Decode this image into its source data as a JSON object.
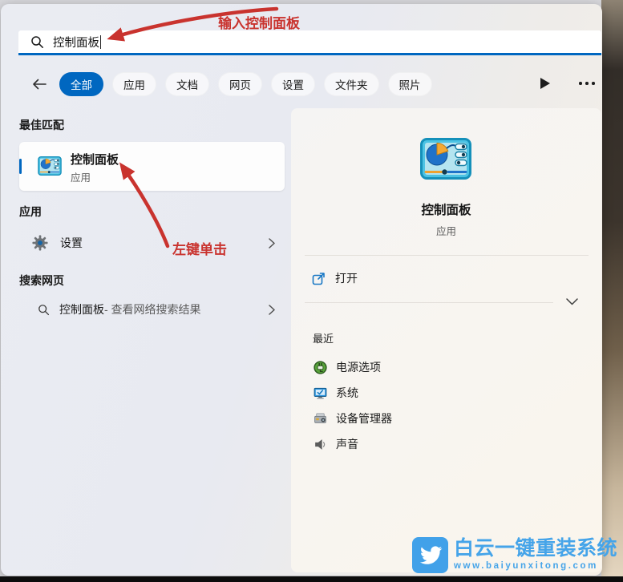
{
  "colors": {
    "accent": "#0067c0",
    "annotation_red": "#c9332e",
    "watermark_blue": "#45a4e9",
    "search_underline": "#0067c0"
  },
  "annotations": {
    "type_hint": "输入控制面板",
    "click_hint": "左键单击"
  },
  "search": {
    "value": "控制面板"
  },
  "tabs": {
    "items": [
      {
        "label": "全部",
        "selected": true
      },
      {
        "label": "应用"
      },
      {
        "label": "文档"
      },
      {
        "label": "网页"
      },
      {
        "label": "设置"
      },
      {
        "label": "文件夹"
      },
      {
        "label": "照片"
      }
    ]
  },
  "left": {
    "best_match_header": "最佳匹配",
    "best_match": {
      "title": "控制面板",
      "subtitle": "应用"
    },
    "apps_header": "应用",
    "apps": [
      {
        "label": "设置"
      }
    ],
    "web_header": "搜索网页",
    "web_results": [
      {
        "query": "控制面板",
        "suffix": " - 查看网络搜索结果"
      }
    ]
  },
  "preview": {
    "title": "控制面板",
    "subtitle": "应用",
    "open_label": "打开",
    "recent_header": "最近",
    "recent": [
      {
        "label": "电源选项"
      },
      {
        "label": "系统"
      },
      {
        "label": "设备管理器"
      },
      {
        "label": "声音"
      }
    ]
  },
  "watermark": {
    "title": "白云一键重装系统",
    "url": "www.baiyunxitong.com"
  }
}
